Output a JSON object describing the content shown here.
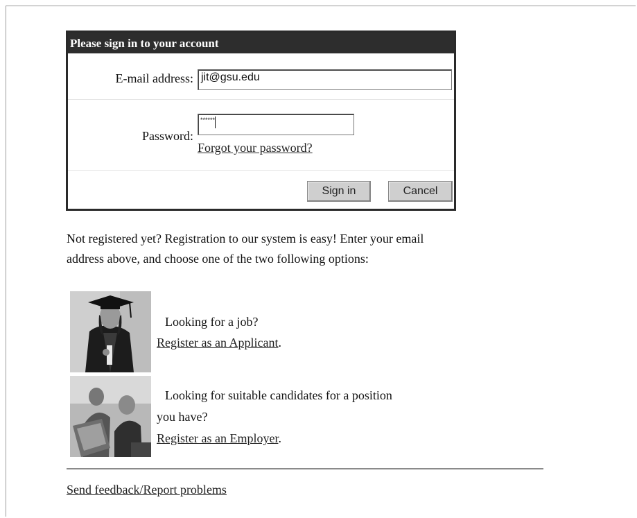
{
  "login": {
    "header": "Please sign in to your account",
    "email_label": "E-mail address:",
    "email_value": "jit@gsu.edu",
    "password_label": "Password:",
    "password_value": "******",
    "forgot_link": "Forgot your password?",
    "sign_in_button": "Sign in",
    "cancel_button": "Cancel"
  },
  "registration": {
    "intro_line1": "Not registered yet? Registration to our system is easy! Enter your email",
    "intro_line2": "address above, and choose one of the two following options:",
    "applicant": {
      "prompt": "Looking for a job?",
      "link": "Register as an Applicant",
      "suffix": "."
    },
    "employer": {
      "prompt_line1": "Looking for suitable candidates for a position",
      "prompt_line2": "you have?",
      "link": "Register as an Employer",
      "suffix": "."
    }
  },
  "footer": {
    "feedback_link": "Send feedback/Report problems"
  },
  "icons": {
    "applicant_image": "graduate-photo",
    "employer_image": "office-workers-photo"
  }
}
